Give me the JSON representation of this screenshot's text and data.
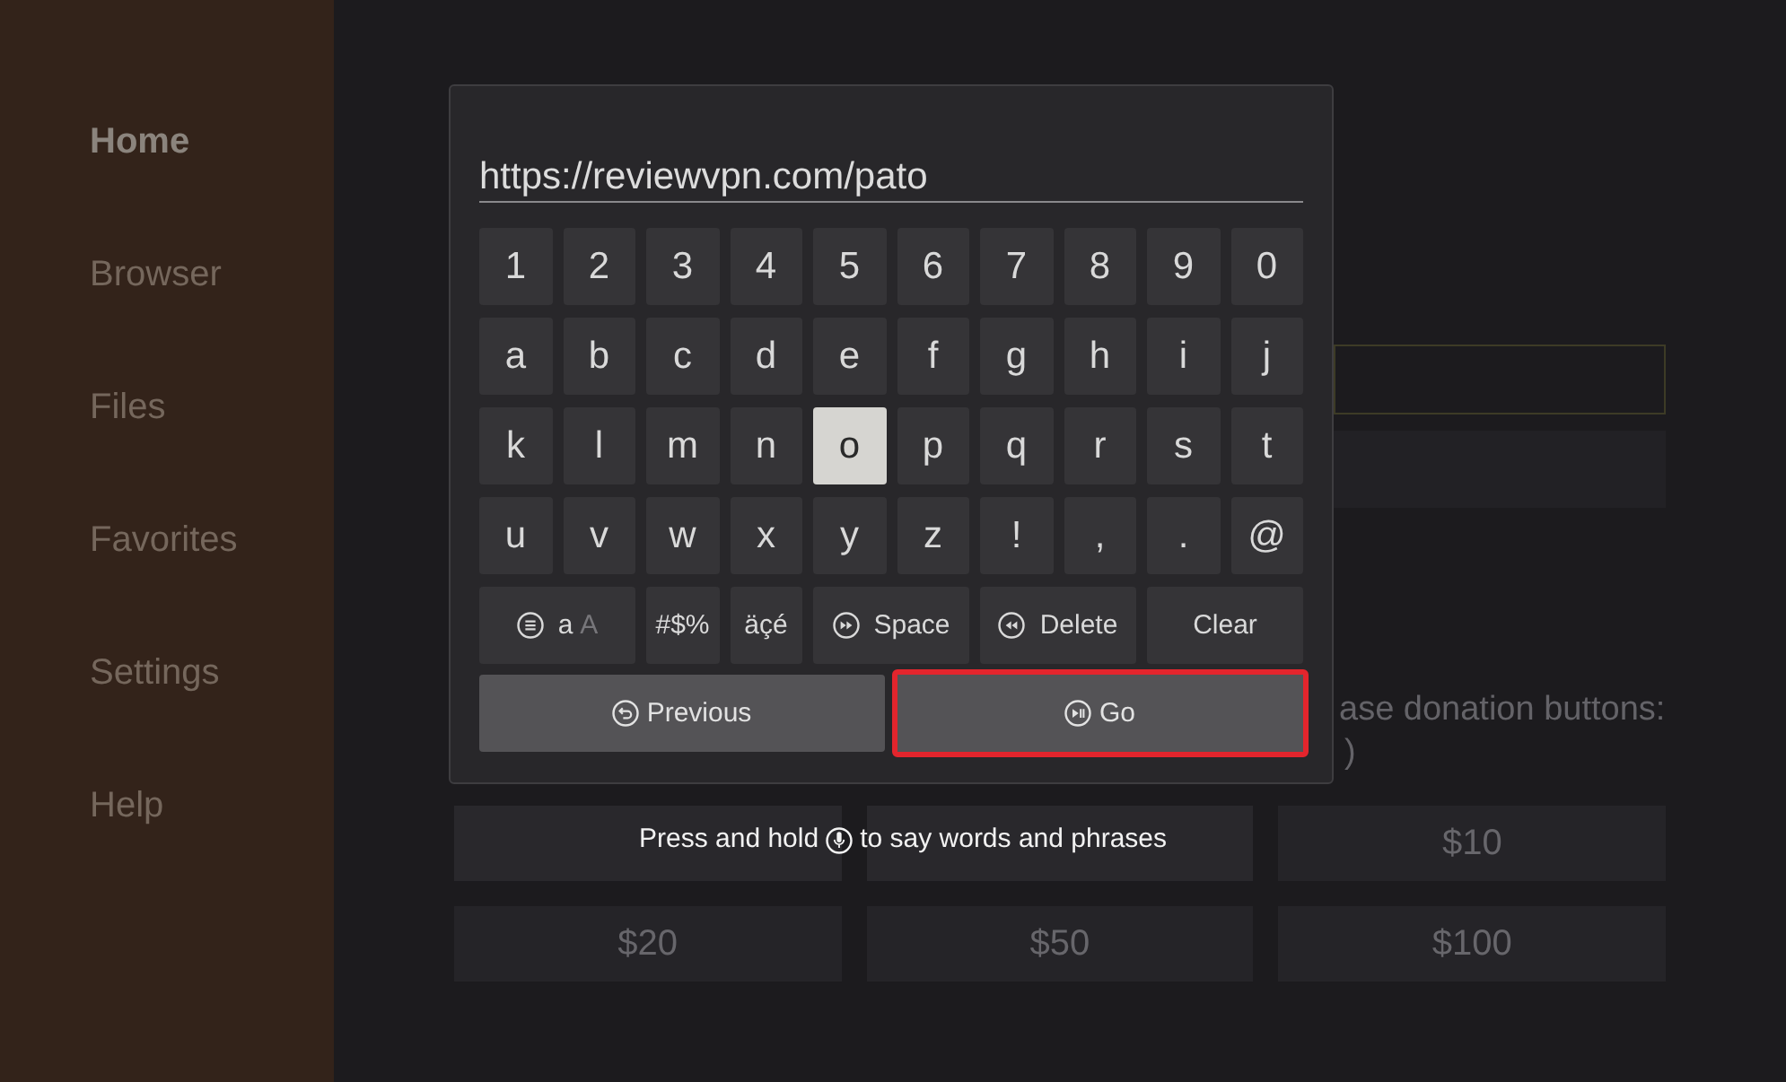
{
  "sidebar": {
    "items": [
      {
        "label": "Home",
        "selected": true
      },
      {
        "label": "Browser",
        "selected": false
      },
      {
        "label": "Files",
        "selected": false
      },
      {
        "label": "Favorites",
        "selected": false
      },
      {
        "label": "Settings",
        "selected": false
      },
      {
        "label": "Help",
        "selected": false
      }
    ]
  },
  "background": {
    "donation_prompt": [
      "ase donation buttons:",
      ")"
    ],
    "donation_buttons": [
      {
        "kind": "blank"
      },
      {
        "kind": "blank"
      },
      {
        "kind": "amount",
        "label": "$10"
      },
      {
        "kind": "amount",
        "label": "$20"
      },
      {
        "kind": "amount",
        "label": "$50"
      },
      {
        "kind": "amount",
        "label": "$100"
      }
    ]
  },
  "dialog": {
    "input": {
      "value": "https://reviewvpn.com/pato"
    },
    "key_rows": [
      [
        {
          "label": "1",
          "selected": false
        },
        {
          "label": "2",
          "selected": false
        },
        {
          "label": "3",
          "selected": false
        },
        {
          "label": "4",
          "selected": false
        },
        {
          "label": "5",
          "selected": false
        },
        {
          "label": "6",
          "selected": false
        },
        {
          "label": "7",
          "selected": false
        },
        {
          "label": "8",
          "selected": false
        },
        {
          "label": "9",
          "selected": false
        },
        {
          "label": "0",
          "selected": false
        }
      ],
      [
        {
          "label": "a",
          "selected": false
        },
        {
          "label": "b",
          "selected": false
        },
        {
          "label": "c",
          "selected": false
        },
        {
          "label": "d",
          "selected": false
        },
        {
          "label": "e",
          "selected": false
        },
        {
          "label": "f",
          "selected": false
        },
        {
          "label": "g",
          "selected": false
        },
        {
          "label": "h",
          "selected": false
        },
        {
          "label": "i",
          "selected": false
        },
        {
          "label": "j",
          "selected": false
        }
      ],
      [
        {
          "label": "k",
          "selected": false
        },
        {
          "label": "l",
          "selected": false
        },
        {
          "label": "m",
          "selected": false
        },
        {
          "label": "n",
          "selected": false
        },
        {
          "label": "o",
          "selected": true
        },
        {
          "label": "p",
          "selected": false
        },
        {
          "label": "q",
          "selected": false
        },
        {
          "label": "r",
          "selected": false
        },
        {
          "label": "s",
          "selected": false
        },
        {
          "label": "t",
          "selected": false
        }
      ],
      [
        {
          "label": "u",
          "selected": false
        },
        {
          "label": "v",
          "selected": false
        },
        {
          "label": "w",
          "selected": false
        },
        {
          "label": "x",
          "selected": false
        },
        {
          "label": "y",
          "selected": false
        },
        {
          "label": "z",
          "selected": false
        },
        {
          "label": "!",
          "selected": false
        },
        {
          "label": ",",
          "selected": false
        },
        {
          "label": ".",
          "selected": false
        },
        {
          "label": "@",
          "selected": false
        }
      ]
    ],
    "function_keys": [
      {
        "kind": "case",
        "selected": false,
        "options": [
          {
            "label": "a",
            "selected": true
          },
          {
            "label": "A",
            "selected": false
          }
        ]
      },
      {
        "kind": "symbols",
        "label": "#$%",
        "selected": false
      },
      {
        "kind": "accents",
        "label": "äçé",
        "selected": false
      },
      {
        "kind": "space",
        "label": "Space",
        "selected": false
      },
      {
        "kind": "delete",
        "label": "Delete",
        "selected": false
      },
      {
        "kind": "clear",
        "label": "Clear",
        "selected": false
      }
    ],
    "actions": [
      {
        "kind": "previous",
        "label": "Previous",
        "selected": false
      },
      {
        "kind": "go",
        "label": "Go",
        "selected": true
      }
    ]
  },
  "voice_hint": {
    "before": "Press and hold",
    "after": "to say words and phrases"
  }
}
